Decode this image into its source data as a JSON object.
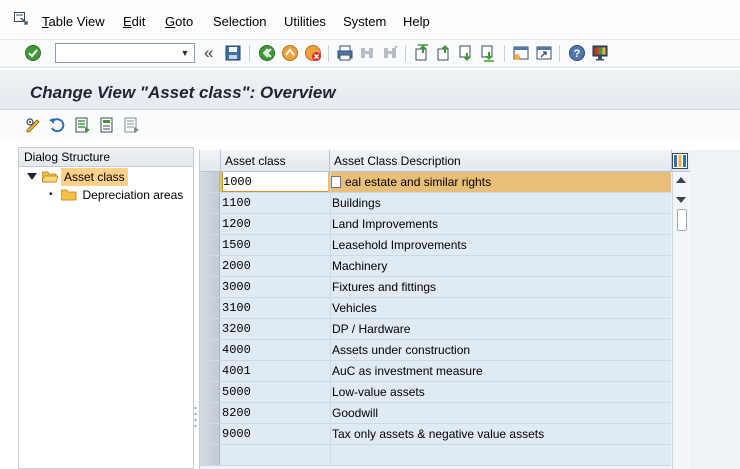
{
  "menu": {
    "items": [
      {
        "mnemonic": "T",
        "rest": "able View"
      },
      {
        "mnemonic": "E",
        "rest": "dit"
      },
      {
        "mnemonic": "G",
        "rest": "oto"
      },
      {
        "mnemonic": "",
        "rest": "Selection"
      },
      {
        "mnemonic": "",
        "rest": "Utilities"
      },
      {
        "mnemonic": "",
        "rest": "System"
      },
      {
        "mnemonic": "",
        "rest": "Help"
      }
    ]
  },
  "toolbar": {
    "command_value": "",
    "chevrons": "«"
  },
  "title": "Change View \"Asset class\": Overview",
  "dialog_structure": {
    "header": "Dialog Structure",
    "nodes": [
      {
        "label": "Asset class",
        "selected": true
      },
      {
        "label": "Depreciation areas",
        "selected": false
      }
    ]
  },
  "grid": {
    "columns": [
      "Asset class",
      "Asset Class Description"
    ],
    "rows": [
      {
        "code": "1000",
        "desc": "eal estate and similar rights"
      },
      {
        "code": "1100",
        "desc": "Buildings"
      },
      {
        "code": "1200",
        "desc": "Land Improvements"
      },
      {
        "code": "1500",
        "desc": "Leasehold Improvements"
      },
      {
        "code": "2000",
        "desc": "Machinery"
      },
      {
        "code": "3000",
        "desc": "Fixtures and fittings"
      },
      {
        "code": "3100",
        "desc": "Vehicles"
      },
      {
        "code": "3200",
        "desc": "DP / Hardware"
      },
      {
        "code": "4000",
        "desc": "Assets under construction"
      },
      {
        "code": "4001",
        "desc": "AuC as investment measure"
      },
      {
        "code": "5000",
        "desc": "Low-value assets"
      },
      {
        "code": "8200",
        "desc": "Goodwill"
      },
      {
        "code": "9000",
        "desc": "Tax only assets & negative value assets"
      },
      {
        "code": "",
        "desc": ""
      }
    ]
  },
  "colors": {
    "selected_row": "#e8bf78",
    "tree_selected": "#fcd088",
    "grid_row": "#dfeaf2"
  }
}
